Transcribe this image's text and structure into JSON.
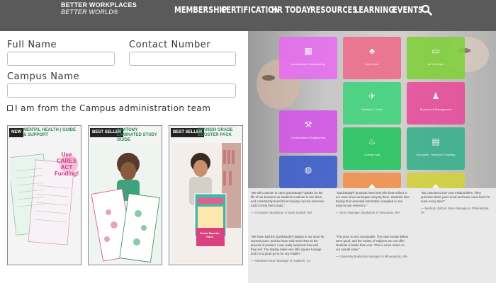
{
  "nav": {
    "logo_line1": "BETTER WORKPLACES",
    "logo_line2": "BETTER WORLD®",
    "items": [
      "MEMBERSHIP",
      "CERTIFICATION",
      "HR TODAY",
      "RESOURCES",
      "LEARNING",
      "EVENTS"
    ],
    "search_icon": "search-icon"
  },
  "form": {
    "full_name_label": "Full Name",
    "contact_label": "Contact Number",
    "campus_label": "Campus Name",
    "admin_checkbox_label": "I am from the Campus administration team",
    "full_name_value": "",
    "contact_value": "",
    "campus_value": ""
  },
  "products": [
    {
      "badge": "NEW",
      "title": "MENTAL HEALTH | GUIDE & SUPPORT",
      "accent": "#2e8b57",
      "extra": "Use CARES ACT Funding!"
    },
    {
      "badge": "BEST SELLER",
      "title": "ANATOMY LAMINATED STUDY GUIDE",
      "accent": "#2e8b57"
    },
    {
      "badge": "BEST SELLER",
      "title": "SPANISH GRADE BOOSTER PACK",
      "accent": "#2e8b57",
      "extra": "Grade Booster Pack"
    }
  ],
  "categories": [
    {
      "label": "Accounting & Bookkeeping",
      "color": "#e86cf0",
      "icon": "calculator-icon"
    },
    {
      "label": "Agriculture",
      "color": "#ee6b8a",
      "icon": "agriculture-icon"
    },
    {
      "label": "Art & Design",
      "color": "#7fd03a",
      "icon": "art-icon"
    },
    {
      "label": "Aviation & Travel",
      "color": "#3ed37b",
      "icon": "plane-icon"
    },
    {
      "label": "Business & Management",
      "color": "#e84b9c",
      "icon": "business-icon"
    },
    {
      "label": "Construction & Engineering",
      "color": "#d454e8",
      "icon": "construction-icon"
    },
    {
      "label": "Culinary Arts",
      "color": "#22c55e",
      "icon": "culinary-icon"
    },
    {
      "label": "Education, Training & Teaching",
      "color": "#36b089",
      "icon": "education-icon"
    },
    {
      "label": "",
      "color": "#3b5bc9",
      "icon": "globe-icon"
    },
    {
      "label": "",
      "color": "#f0914a",
      "icon": "category-icon"
    },
    {
      "label": "",
      "color": "#d2d23a",
      "icon": "category-icon"
    }
  ],
  "testimonials": [
    {
      "text": "\"We will continue to carry QuickStudy® guides for the life of our business as students continue to use them, and consistently benefit from having concise reference tools to help them study.\"",
      "by": "— Co-Owner, Bookstore in Saint Joseph, MO"
    },
    {
      "text": "\"QuickStudy® products have been the best-sellers in our store since we began carrying them. Students love having their essential information compiled in one easy-to-use reference.\"",
      "by": "— Store Manager, Bookstore in Vancouver, WA"
    },
    {
      "text": "\"My customers love your medical titles. They purchase them year-round and have come back for more every time!\"",
      "by": "— Medical Uniform Store Manager in Philadelphia, PA"
    },
    {
      "text": "\"We have had the QuickStudy® display in our store for several years, and we have sold more than 5x the amount of product. I was really surprised how well they sell. The display takes very little square footage and it is a great go-to for any retailer.\"",
      "by": "— Hardware Store Manager in Anaheim, CA"
    },
    {
      "text": "\"The price is very reasonable. The total overall dollars were good, and the variety of subjects we can offer students is better than ever. This is a true return on our overall value.\"",
      "by": "— University Bookstore Manager in Minneapolis, MN"
    }
  ]
}
